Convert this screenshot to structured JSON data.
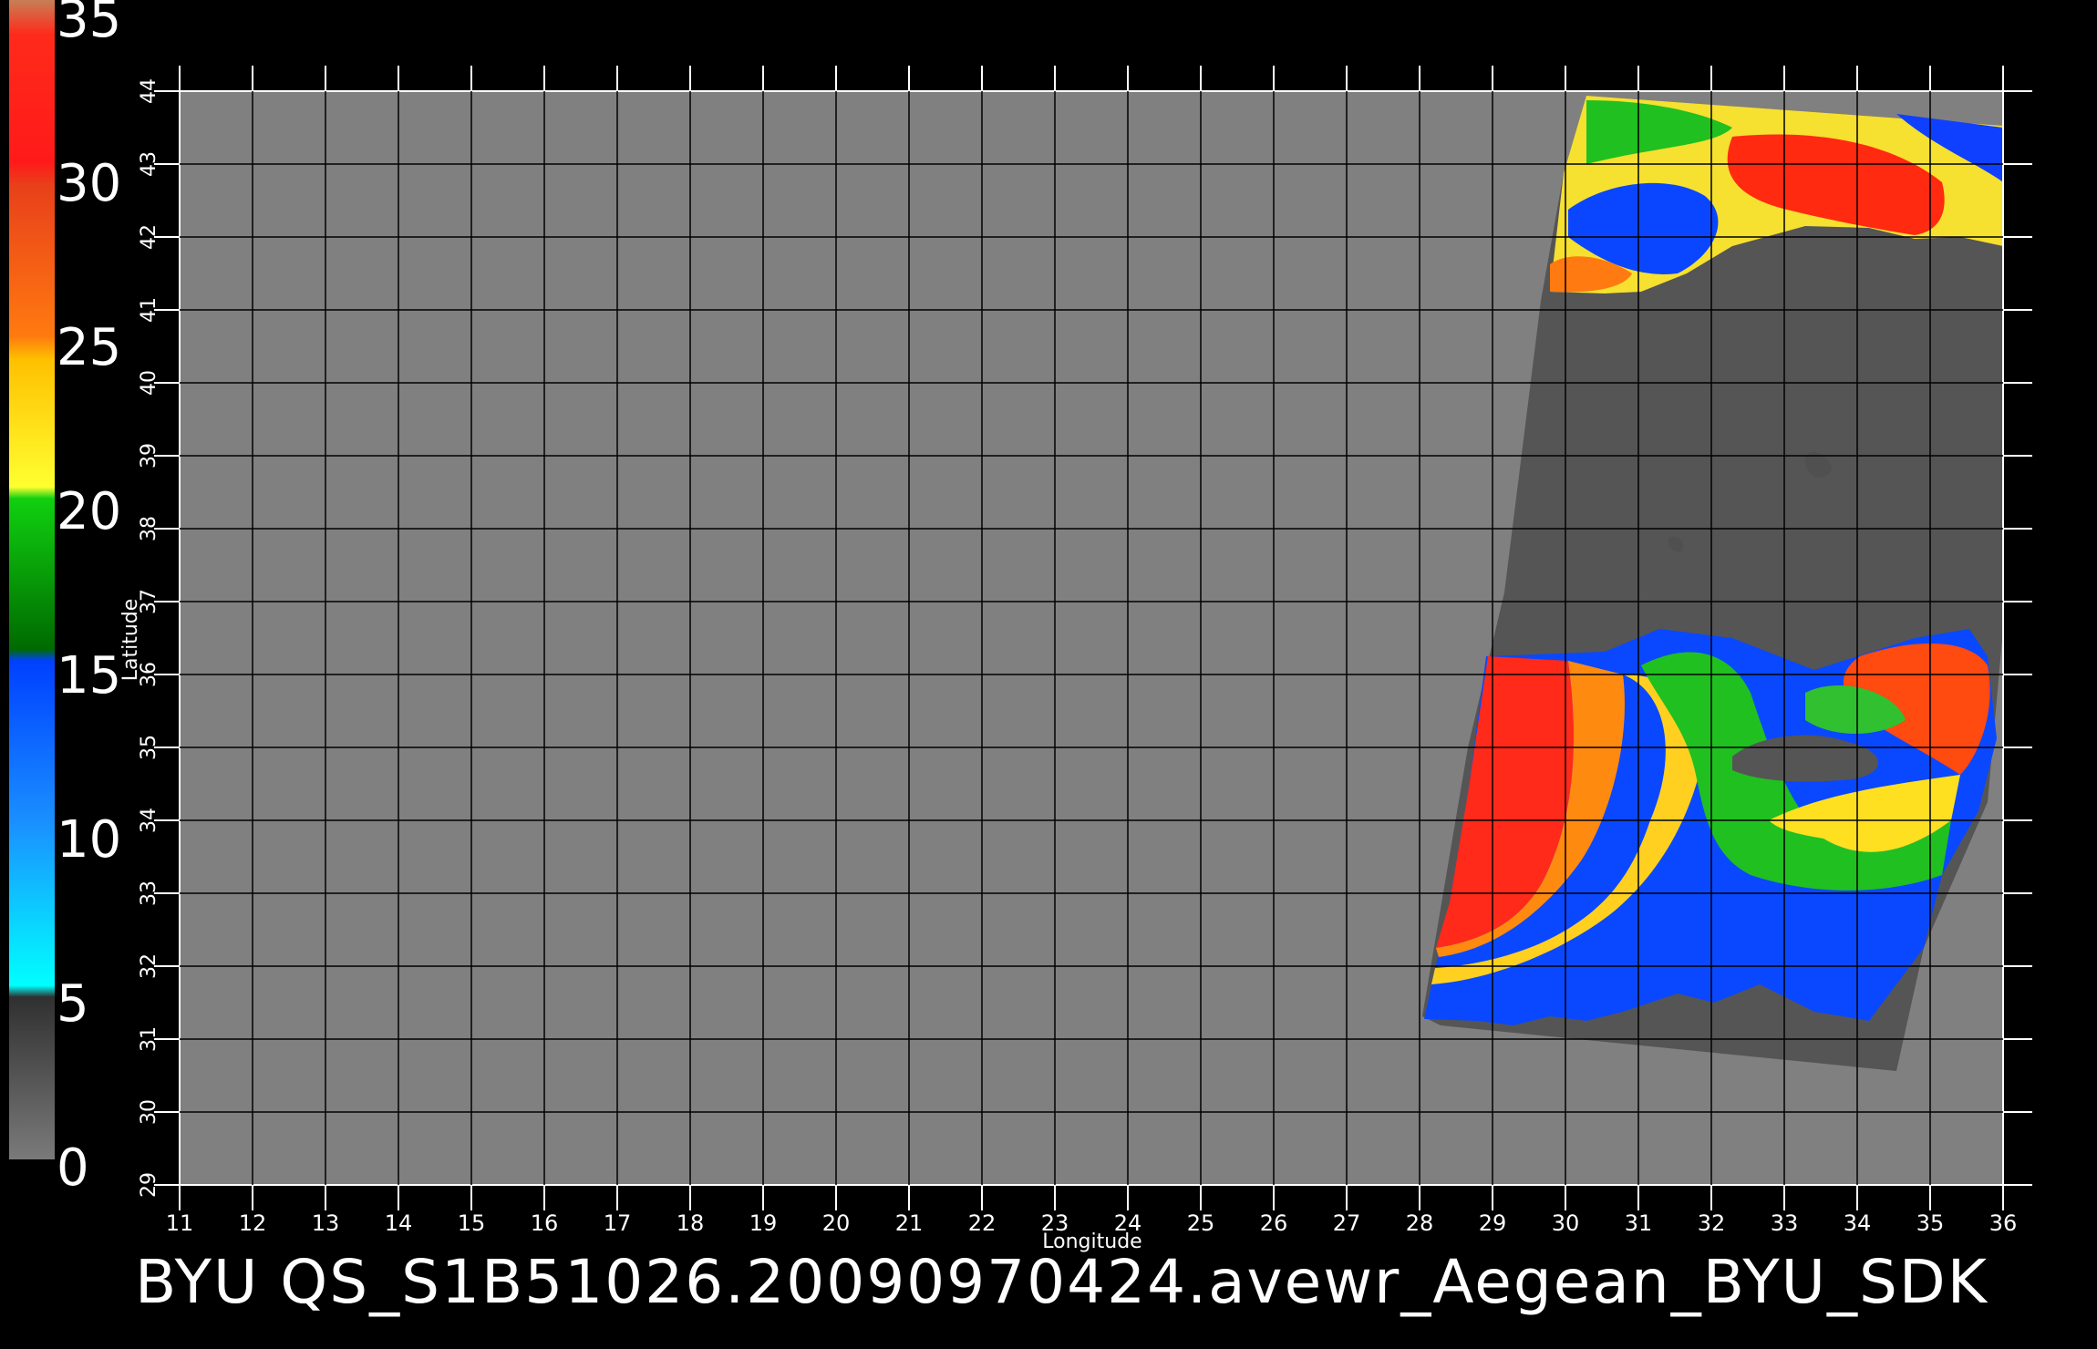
{
  "colorbar": {
    "ticks": [
      "35",
      "30",
      "25",
      "20",
      "15",
      "10",
      "5",
      "0"
    ],
    "stops": [
      "#c77f55",
      "#ff1a1a",
      "#e8401a",
      "#ff7a10",
      "#ffc000",
      "#ffff30",
      "#10d010",
      "#006a00",
      "#0040ff",
      "#1a90ff",
      "#00ffff",
      "#303030",
      "#7a7a7a"
    ]
  },
  "axes": {
    "xlabel": "Longitude",
    "ylabel": "Latitude",
    "x_ticks": [
      "11",
      "12",
      "13",
      "14",
      "15",
      "16",
      "17",
      "18",
      "19",
      "20",
      "21",
      "22",
      "23",
      "24",
      "25",
      "26",
      "27",
      "28",
      "29",
      "30",
      "31",
      "32",
      "33",
      "34",
      "35",
      "36"
    ],
    "y_ticks": [
      "29",
      "30",
      "31",
      "32",
      "33",
      "34",
      "35",
      "36",
      "37",
      "38",
      "39",
      "40",
      "41",
      "42",
      "43",
      "44"
    ],
    "xlim": [
      11,
      36
    ],
    "ylim": [
      29,
      44
    ],
    "grid": true
  },
  "caption": "BYU  QS_S1B51026.20090970424.avewr_Aegean_BYU_SDK",
  "colors": {
    "background": "#000000",
    "ocean_nodata": "#808080",
    "land": "#555555",
    "grid": "#000000"
  },
  "swath": {
    "lon_range": [
      28,
      36
    ],
    "lat_range": [
      31,
      44
    ]
  }
}
